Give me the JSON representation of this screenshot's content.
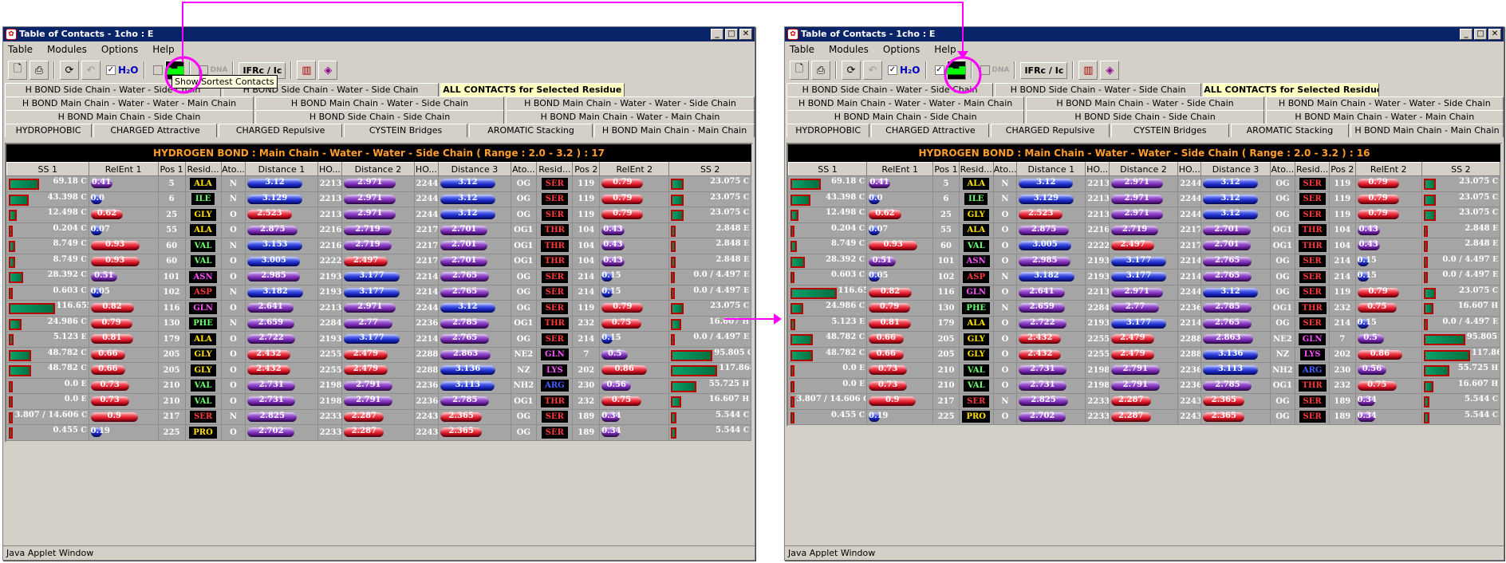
{
  "window": {
    "title": "Table of Contacts - 1cho : E",
    "status": "Java Applet Window"
  },
  "menu": [
    "Table",
    "Modules",
    "Options",
    "Help"
  ],
  "toolbar": {
    "h2o": "H₂O",
    "dna": "DNA",
    "ifrc": "IFRc / Ic",
    "tooltip": "Show Sortest Contacts"
  },
  "tabs": {
    "row1": [
      "H BOND Side Chain - Water - Side Chain",
      "H BOND Side Chain - Water - Side Chain",
      "ALL CONTACTS for Selected Residue"
    ],
    "row2": [
      "H BOND Main Chain - Water - Water - Main Chain",
      "H BOND Main Chain - Water - Side Chain",
      "H BOND Main Chain - Water - Water - Side Chain"
    ],
    "row3": [
      "H BOND Main Chain - Side Chain",
      "H BOND Side Chain - Side Chain",
      "H BOND Main Chain - Water - Main Chain"
    ],
    "row4": [
      "HYDROPHOBIC",
      "CHARGED Attractive",
      "CHARGED Repulsive",
      "CYSTEIN Bridges",
      "AROMATIC Stacking",
      "H BOND Main Chain - Main Chain"
    ]
  },
  "columns": [
    "SS 1",
    "RelEnt 1",
    "Pos 1",
    "Resid...",
    "Ato...",
    "Distance 1",
    "HO...",
    "Distance 2",
    "HO...",
    "Distance 3",
    "Ato...",
    "Resid...",
    "Pos 2",
    "RelEnt 2",
    "SS 2"
  ],
  "left": {
    "banner": "HYDROGEN BOND : Main Chain - Water - Water - Side Chain ( Range : 2.0 - 3.2 ) : 17",
    "rows": [
      [
        "69.18",
        "C",
        "0.41",
        "5",
        "ALA",
        "N",
        "3.12",
        "2213",
        "2.971",
        "2244",
        "3.12",
        "OG",
        "SER",
        "119",
        "0.79",
        "23.075",
        "C"
      ],
      [
        "43.398",
        "C",
        "0.0",
        "6",
        "ILE",
        "N",
        "3.129",
        "2213",
        "2.971",
        "2244",
        "3.12",
        "OG",
        "SER",
        "119",
        "0.79",
        "23.075",
        "C"
      ],
      [
        "12.498",
        "C",
        "0.62",
        "25",
        "GLY",
        "O",
        "2.523",
        "2213",
        "2.971",
        "2244",
        "3.12",
        "OG",
        "SER",
        "119",
        "0.79",
        "23.075",
        "C"
      ],
      [
        "0.204",
        "C",
        "0.07",
        "55",
        "ALA",
        "O",
        "2.875",
        "2216",
        "2.719",
        "2217",
        "2.701",
        "OG1",
        "THR",
        "104",
        "0.43",
        "2.848",
        "E"
      ],
      [
        "8.749",
        "C",
        "0.93",
        "60",
        "VAL",
        "N",
        "3.153",
        "2216",
        "2.719",
        "2217",
        "2.701",
        "OG1",
        "THR",
        "104",
        "0.43",
        "2.848",
        "E"
      ],
      [
        "8.749",
        "C",
        "0.93",
        "60",
        "VAL",
        "O",
        "3.005",
        "2222",
        "2.497",
        "2217",
        "2.701",
        "OG1",
        "THR",
        "104",
        "0.43",
        "2.848",
        "E"
      ],
      [
        "28.392",
        "C",
        "0.51",
        "101",
        "ASN",
        "O",
        "2.985",
        "2193",
        "3.177",
        "2214",
        "2.765",
        "OG",
        "SER",
        "214",
        "0.15",
        "0.0 / 4.497",
        "E"
      ],
      [
        "0.603",
        "C",
        "0.05",
        "102",
        "ASP",
        "N",
        "3.182",
        "2193",
        "3.177",
        "2214",
        "2.765",
        "OG",
        "SER",
        "214",
        "0.15",
        "0.0 / 4.497",
        "E"
      ],
      [
        "116.655",
        "C",
        "0.82",
        "116",
        "GLN",
        "O",
        "2.641",
        "2213",
        "2.971",
        "2244",
        "3.12",
        "OG",
        "SER",
        "119",
        "0.79",
        "23.075",
        "C"
      ],
      [
        "24.986",
        "C",
        "0.79",
        "130",
        "PHE",
        "N",
        "2.659",
        "2284",
        "2.77",
        "2236",
        "2.785",
        "OG1",
        "THR",
        "232",
        "0.75",
        "16.607",
        "H"
      ],
      [
        "5.123",
        "E",
        "0.81",
        "179",
        "ALA",
        "O",
        "2.722",
        "2193",
        "3.177",
        "2214",
        "2.765",
        "OG",
        "SER",
        "214",
        "0.15",
        "0.0 / 4.497",
        "E"
      ],
      [
        "48.782",
        "C",
        "0.66",
        "205",
        "GLY",
        "O",
        "2.432",
        "2255",
        "2.479",
        "2288",
        "2.863",
        "NE2",
        "GLN",
        "7",
        "0.5",
        "95.805",
        "C"
      ],
      [
        "48.782",
        "C",
        "0.66",
        "205",
        "GLY",
        "O",
        "2.432",
        "2255",
        "2.479",
        "2288",
        "3.136",
        "NZ",
        "LYS",
        "202",
        "0.86",
        "117.868",
        "C"
      ],
      [
        "0.0",
        "E",
        "0.73",
        "210",
        "VAL",
        "O",
        "2.731",
        "2198",
        "2.791",
        "2236",
        "3.113",
        "NH2",
        "ARG",
        "230",
        "0.56",
        "55.725",
        "H"
      ],
      [
        "0.0",
        "E",
        "0.73",
        "210",
        "VAL",
        "O",
        "2.731",
        "2198",
        "2.791",
        "2236",
        "2.785",
        "OG1",
        "THR",
        "232",
        "0.75",
        "16.607",
        "H"
      ],
      [
        "3.807 / 14.606",
        "C",
        "0.9",
        "217",
        "SER",
        "N",
        "2.825",
        "2233",
        "2.287",
        "2243",
        "2.365",
        "OG",
        "SER",
        "189",
        "0.34",
        "5.544",
        "C"
      ],
      [
        "0.455",
        "C",
        "0.19",
        "225",
        "PRO",
        "O",
        "2.702",
        "2233",
        "2.287",
        "2243",
        "2.365",
        "OG",
        "SER",
        "189",
        "0.34",
        "5.544",
        "C"
      ]
    ]
  },
  "right": {
    "banner": "HYDROGEN BOND : Main Chain - Water - Water - Side Chain ( Range : 2.0 - 3.2 ) : 16",
    "rows": [
      [
        "69.18",
        "C",
        "0.41",
        "5",
        "ALA",
        "N",
        "3.12",
        "2213",
        "2.971",
        "2244",
        "3.12",
        "OG",
        "SER",
        "119",
        "0.79",
        "23.075",
        "C"
      ],
      [
        "43.398",
        "C",
        "0.0",
        "6",
        "ILE",
        "N",
        "3.129",
        "2213",
        "2.971",
        "2244",
        "3.12",
        "OG",
        "SER",
        "119",
        "0.79",
        "23.075",
        "C"
      ],
      [
        "12.498",
        "C",
        "0.62",
        "25",
        "GLY",
        "O",
        "2.523",
        "2213",
        "2.971",
        "2244",
        "3.12",
        "OG",
        "SER",
        "119",
        "0.79",
        "23.075",
        "C"
      ],
      [
        "0.204",
        "C",
        "0.07",
        "55",
        "ALA",
        "O",
        "2.875",
        "2216",
        "2.719",
        "2217",
        "2.701",
        "OG1",
        "THR",
        "104",
        "0.43",
        "2.848",
        "E"
      ],
      [
        "8.749",
        "C",
        "0.93",
        "60",
        "VAL",
        "O",
        "3.005",
        "2222",
        "2.497",
        "2217",
        "2.701",
        "OG1",
        "THR",
        "104",
        "0.43",
        "2.848",
        "E"
      ],
      [
        "28.392",
        "C",
        "0.51",
        "101",
        "ASN",
        "O",
        "2.985",
        "2193",
        "3.177",
        "2214",
        "2.765",
        "OG",
        "SER",
        "214",
        "0.15",
        "0.0 / 4.497",
        "E"
      ],
      [
        "0.603",
        "C",
        "0.05",
        "102",
        "ASP",
        "N",
        "3.182",
        "2193",
        "3.177",
        "2214",
        "2.765",
        "OG",
        "SER",
        "214",
        "0.15",
        "0.0 / 4.497",
        "E"
      ],
      [
        "116.655",
        "C",
        "0.82",
        "116",
        "GLN",
        "O",
        "2.641",
        "2213",
        "2.971",
        "2244",
        "3.12",
        "OG",
        "SER",
        "119",
        "0.79",
        "23.075",
        "C"
      ],
      [
        "24.986",
        "C",
        "0.79",
        "130",
        "PHE",
        "N",
        "2.659",
        "2284",
        "2.77",
        "2236",
        "2.785",
        "OG1",
        "THR",
        "232",
        "0.75",
        "16.607",
        "H"
      ],
      [
        "5.123",
        "E",
        "0.81",
        "179",
        "ALA",
        "O",
        "2.722",
        "2193",
        "3.177",
        "2214",
        "2.765",
        "OG",
        "SER",
        "214",
        "0.15",
        "0.0 / 4.497",
        "E"
      ],
      [
        "48.782",
        "C",
        "0.66",
        "205",
        "GLY",
        "O",
        "2.432",
        "2255",
        "2.479",
        "2288",
        "2.863",
        "NE2",
        "GLN",
        "7",
        "0.5",
        "95.805",
        "C"
      ],
      [
        "48.782",
        "C",
        "0.66",
        "205",
        "GLY",
        "O",
        "2.432",
        "2255",
        "2.479",
        "2288",
        "3.136",
        "NZ",
        "LYS",
        "202",
        "0.86",
        "117.868",
        "C"
      ],
      [
        "0.0",
        "E",
        "0.73",
        "210",
        "VAL",
        "O",
        "2.731",
        "2198",
        "2.791",
        "2236",
        "3.113",
        "NH2",
        "ARG",
        "230",
        "0.56",
        "55.725",
        "H"
      ],
      [
        "0.0",
        "E",
        "0.73",
        "210",
        "VAL",
        "O",
        "2.731",
        "2198",
        "2.791",
        "2236",
        "2.785",
        "OG1",
        "THR",
        "232",
        "0.75",
        "16.607",
        "H"
      ],
      [
        "3.807 / 14.606",
        "C",
        "0.9",
        "217",
        "SER",
        "N",
        "2.825",
        "2233",
        "2.287",
        "2243",
        "2.365",
        "OG",
        "SER",
        "189",
        "0.34",
        "5.544",
        "C"
      ],
      [
        "0.455",
        "C",
        "0.19",
        "225",
        "PRO",
        "O",
        "2.702",
        "2233",
        "2.287",
        "2243",
        "2.365",
        "OG",
        "SER",
        "189",
        "0.34",
        "5.544",
        "C"
      ]
    ]
  },
  "colors": {
    "annotation": "#ff00ff",
    "banner_text": "#ff9d2c",
    "selected_tab": "#ffffc0"
  }
}
